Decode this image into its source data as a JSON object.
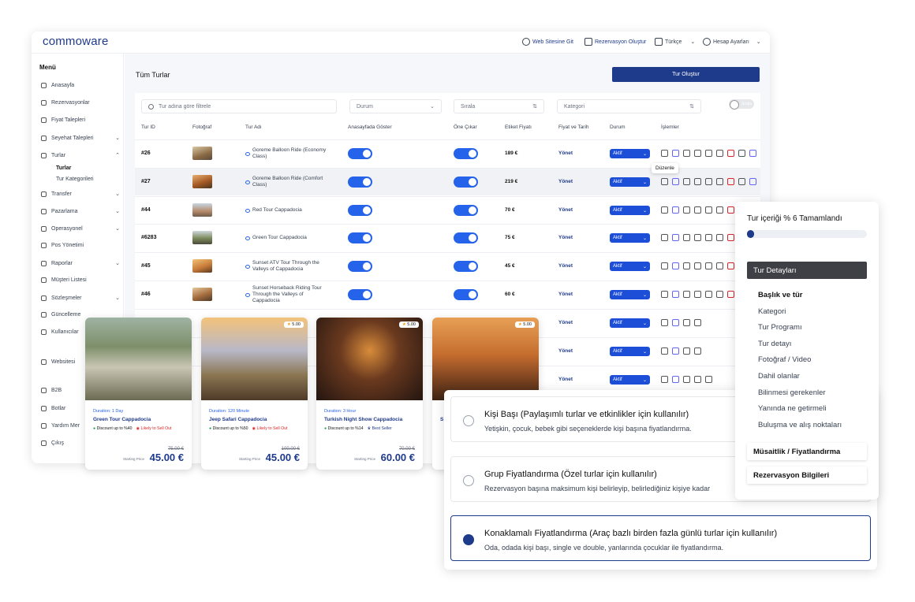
{
  "app": {
    "logo": "commoware",
    "topbar": {
      "website": "Web Sitesine Git",
      "reservation": "Rezervasyon Oluştur",
      "language": "Türkçe",
      "account": "Hesap Ayarları"
    }
  },
  "sidebar": {
    "heading": "Menü",
    "items": [
      {
        "label": "Anasayfa"
      },
      {
        "label": "Rezervasyonlar"
      },
      {
        "label": "Fiyat Talepleri"
      },
      {
        "label": "Seyehat Talepleri"
      },
      {
        "label": "Turlar"
      },
      {
        "label": "Transfer"
      },
      {
        "label": "Pazarlama"
      },
      {
        "label": "Operasyonel"
      },
      {
        "label": "Pos Yönetimi"
      },
      {
        "label": "Raporlar"
      },
      {
        "label": "Müşteri Listesi"
      },
      {
        "label": "Sözleşmeler"
      },
      {
        "label": "Güncelleme"
      },
      {
        "label": "Kullanıcılar"
      },
      {
        "label": "Websitesi"
      },
      {
        "label": "B2B"
      },
      {
        "label": "Botlar"
      },
      {
        "label": "Yardım Mer"
      },
      {
        "label": "Çıkış"
      }
    ],
    "sub": {
      "active": "Turlar",
      "other": "Tur Kategorileri"
    }
  },
  "main": {
    "title": "Tüm Turlar",
    "create_button": "Tur Oluştur",
    "filters": {
      "search_placeholder": "Tur adına göre filtrele",
      "status": "Durum",
      "sort": "Sırala",
      "category": "Kategori",
      "toggle": "Sırala"
    },
    "columns": [
      "Tur ID",
      "Fotoğraf",
      "Tur Adı",
      "Anasayfada Göster",
      "Öne Çıkar",
      "Etiket Fiyatı",
      "Fiyat ve Tarih",
      "Durum",
      "İşlemler"
    ],
    "rows": [
      {
        "id": "#26",
        "name": "Goreme Balloon Ride (Economy Class)",
        "price": "189 €",
        "manage": "Yönet",
        "status": "Aktif"
      },
      {
        "id": "#27",
        "name": "Goreme Balloon Ride (Comfort Class)",
        "price": "219 €",
        "manage": "Yönet",
        "status": "Aktif"
      },
      {
        "id": "#44",
        "name": "Red Tour Cappadocia",
        "price": "70 €",
        "manage": "Yönet",
        "status": "Aktif"
      },
      {
        "id": "#6283",
        "name": "Green Tour Cappadocia",
        "price": "75 €",
        "manage": "Yönet",
        "status": "Aktif"
      },
      {
        "id": "#45",
        "name": "Sunset ATV Tour Through the Valleys of Cappadocia",
        "price": "45 €",
        "manage": "Yönet",
        "status": "Aktif"
      },
      {
        "id": "#46",
        "name": "Sunset Horseback Riding Tour Through the Valleys of Cappadocia",
        "price": "60 €",
        "manage": "Yönet",
        "status": "Aktif"
      },
      {
        "id": "",
        "name": "",
        "price": "",
        "manage": "Yönet",
        "status": "Aktif"
      },
      {
        "id": "",
        "name": "",
        "price": "",
        "manage": "Yönet",
        "status": "Aktif"
      },
      {
        "id": "",
        "name": "",
        "price": "",
        "manage": "Yönet",
        "status": "Aktif"
      }
    ],
    "tooltip": "Düzenle"
  },
  "cards": [
    {
      "duration": "Duration: 1 Day",
      "name": "Green Tour Cappadocia",
      "discount": "Discount up to %40",
      "badge": "Likely to Sell Out",
      "badge_type": "red",
      "old_price": "75.00 €",
      "starting": "Starting Price",
      "price": "45.00 €",
      "rating": ""
    },
    {
      "duration": "Duration: 120 Minute",
      "name": "Jeep Safari Cappadocia",
      "discount": "Discount up to %50",
      "badge": "Likely to Sell Out",
      "badge_type": "red",
      "old_price": "100.00 €",
      "starting": "Starting Price",
      "price": "45.00 €",
      "rating": "5.00"
    },
    {
      "duration": "Duration: 3 Hour",
      "name": "Turkish Night Show Cappadocia",
      "discount": "Discount up to %14",
      "badge": "Best Seller",
      "badge_type": "blue",
      "old_price": "70.00 €",
      "starting": "Starting Price",
      "price": "60.00 €",
      "rating": "5.00"
    },
    {
      "duration": "",
      "name": "S",
      "discount": "",
      "badge": "",
      "badge_type": "",
      "old_price": "",
      "starting": "",
      "price": "",
      "rating": "5.00"
    }
  ],
  "pricing": {
    "options": [
      {
        "title": "Kişi Başı (Paylaşımlı turlar ve etkinlikler için kullanılır)",
        "desc": "Yetişkin, çocuk, bebek gibi seçeneklerde kişi başına fiyatlandırma.",
        "selected": false
      },
      {
        "title": "Grup Fiyatlandırma (Özel turlar için kullanılır)",
        "desc": "Rezervasyon başına maksimum kişi belirleyip, belirlediğiniz kişiye kadar",
        "selected": false
      },
      {
        "title": "Konaklamalı Fiyatlandırma (Araç bazlı birden fazla günlü turlar için kullanılır)",
        "desc": "Oda, odada kişi başı, single ve double, yanlarında çocuklar ile fiyatlandırma.",
        "selected": true
      }
    ]
  },
  "tour_panel": {
    "title": "Tur içeriği % 6 Tamamlandı",
    "progress": 0.06,
    "section_active": "Tur Detayları",
    "items": [
      "Başlık ve tür",
      "Kategori",
      "Tur Programı",
      "Tur detayı",
      "Fotoğraf / Video",
      "Dahil olanlar",
      "Bilinmesi gerekenler",
      "Yanında ne getirmeli",
      "Buluşma ve alış noktaları"
    ],
    "section2": "Müsaitlik / Fiyatlandırma",
    "section3": "Rezervasyon Bilgileri"
  },
  "colors": {
    "brand": "#1e3a8a",
    "accent": "#2563eb",
    "danger": "#dc2626"
  }
}
